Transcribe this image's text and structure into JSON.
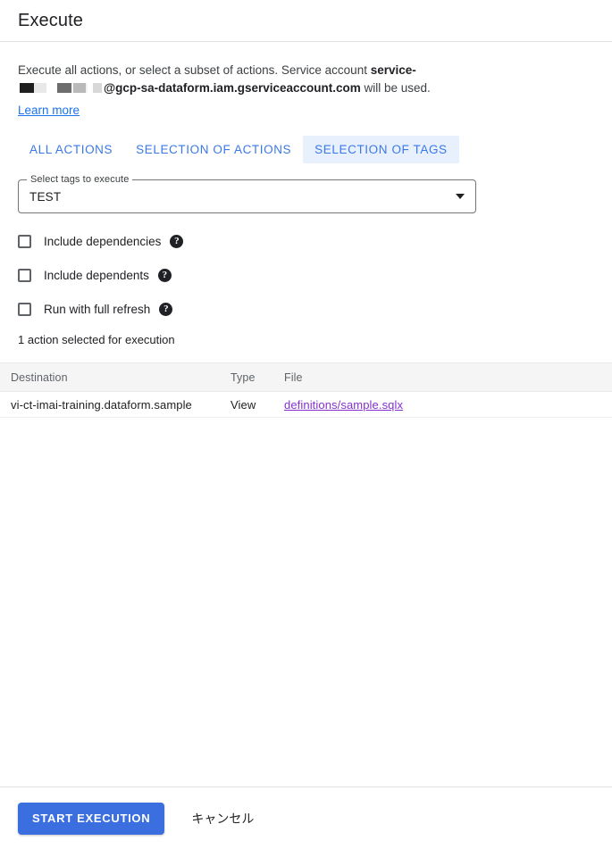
{
  "dialog": {
    "title": "Execute"
  },
  "description": {
    "text_part1": "Execute all actions, or select a subset of actions. Service account ",
    "bold_part1": "service-",
    "redacted_label": "redacted-service-account-id",
    "bold_part2": "@gcp-sa-dataform.iam.gserviceaccount.com",
    "text_part2": " will be used.",
    "learn_more": "Learn more"
  },
  "tabs": [
    {
      "label": "ALL ACTIONS",
      "selected": false
    },
    {
      "label": "SELECTION OF ACTIONS",
      "selected": false
    },
    {
      "label": "SELECTION OF TAGS",
      "selected": true
    }
  ],
  "select_field": {
    "legend": "Select tags to execute",
    "value": "TEST",
    "arrow_icon": "chevron-down-icon"
  },
  "checkboxes": [
    {
      "label": "Include dependencies",
      "checked": false,
      "help_icon": "help-circle-icon"
    },
    {
      "label": "Include dependents",
      "checked": false,
      "help_icon": "help-circle-icon"
    },
    {
      "label": "Run with full refresh",
      "checked": false,
      "help_icon": "help-circle-icon"
    }
  ],
  "selected_count": "1 action selected for execution",
  "table": {
    "headers": [
      "Destination",
      "Type",
      "File"
    ],
    "rows": [
      {
        "destination": "vi-ct-imai-training.dataform.sample",
        "type": "View",
        "file": "definitions/sample.sqlx"
      }
    ]
  },
  "footer": {
    "primary_label": "START EXECUTION",
    "cancel_label": "キャンセル"
  },
  "colors": {
    "accent_blue": "#3b6fe0",
    "tab_blue": "#3b78e7",
    "tab_selected_bg": "#e8f0fe",
    "link_blue": "#1a73e8",
    "visited_link_purple": "#8430ce",
    "table_header_bg": "#f5f5f5"
  }
}
